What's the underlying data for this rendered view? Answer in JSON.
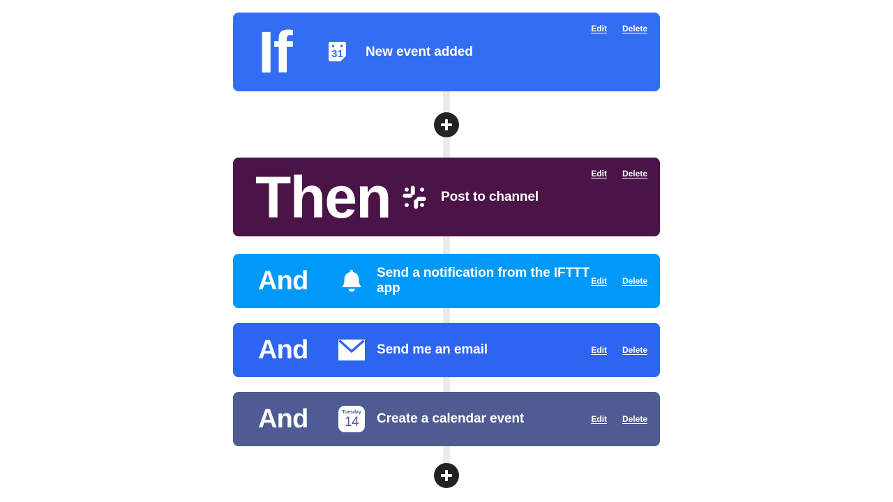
{
  "applet": {
    "connector_color": "#ebebeb",
    "blocks": [
      {
        "keyword": "If",
        "service_icon": "google-calendar-icon",
        "action_label": "New event added",
        "color": "#336DF2",
        "edit_label": "Edit",
        "delete_label": "Delete"
      },
      {
        "keyword": "Then",
        "service_icon": "slack-icon",
        "action_label": "Post to channel",
        "color": "#4A1447",
        "edit_label": "Edit",
        "delete_label": "Delete"
      },
      {
        "keyword": "And",
        "service_icon": "bell-notification-icon",
        "action_label": "Send a notification from the IFTTT app",
        "color": "#0099F7",
        "edit_label": "Edit",
        "delete_label": "Delete"
      },
      {
        "keyword": "And",
        "service_icon": "envelope-email-icon",
        "action_label": "Send me an email",
        "color": "#2D64F0",
        "edit_label": "Edit",
        "delete_label": "Delete"
      },
      {
        "keyword": "And",
        "service_icon": "ios-calendar-icon",
        "action_label": "Create a calendar event",
        "color": "#4F5B93",
        "edit_label": "Edit",
        "delete_label": "Delete"
      }
    ],
    "add_buttons": {
      "icon": "plus-icon",
      "color": "#222222"
    },
    "icon_details": {
      "google_calendar_day": "31",
      "ios_calendar_weekday": "Tuesday",
      "ios_calendar_day": "14"
    }
  }
}
